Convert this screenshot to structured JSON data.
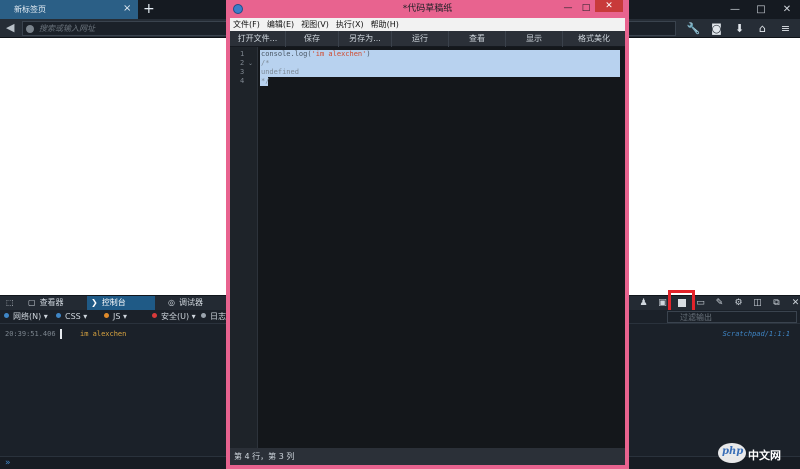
{
  "browser": {
    "tab_title": "新标签页",
    "tab_close": "×",
    "new_tab": "+",
    "window_controls": [
      "—",
      "□",
      "✕"
    ],
    "url_placeholder": "搜索或输入网址",
    "nav_icons": [
      "wrench-icon",
      "pocket-icon",
      "download-icon",
      "home-icon",
      "menu-icon"
    ],
    "nav_glyphs": [
      "🔧",
      "◙",
      "⬇",
      "⌂",
      "≡"
    ]
  },
  "devtools": {
    "tabs": [
      {
        "label": "查看器",
        "icon": "inspector-icon",
        "glyph": "▢"
      },
      {
        "label": "控制台",
        "icon": "console-icon",
        "glyph": "❯"
      },
      {
        "label": "调试器",
        "icon": "debugger-icon",
        "glyph": "◎"
      }
    ],
    "right_icons": [
      "paintbrush-icon",
      "frames-icon",
      "scratchpad-icon",
      "responsive-icon",
      "eyedropper-icon",
      "gear-icon",
      "dock-side-icon",
      "popout-icon",
      "close-icon"
    ],
    "right_glyphs": [
      "♟",
      "▣",
      "",
      "▭",
      "✎",
      "⚙",
      "◫",
      "⧉",
      "✕"
    ],
    "filters": [
      {
        "label": "网络(N)",
        "dot": "#3f86c6",
        "arrow": "▾"
      },
      {
        "label": "CSS",
        "dot": "#3f86c6",
        "arrow": "▾"
      },
      {
        "label": "JS",
        "dot": "#e08b2a",
        "arrow": "▾"
      },
      {
        "label": "安全(U)",
        "dot": "#d83a3a",
        "arrow": "▾"
      },
      {
        "label": "日志",
        "dot": "#9aa3ac",
        "arrow": ""
      }
    ],
    "filter_placeholder": "过滤输出",
    "log": {
      "time": "20:39:51.406",
      "message": "im alexchen",
      "source": "Scratchpad/1:1:1"
    },
    "prompt": "»"
  },
  "scratchpad": {
    "title": "*代码草稿纸",
    "controls": [
      "—",
      "□"
    ],
    "close": "✕",
    "menu": [
      "文件(F)",
      "编辑(E)",
      "视图(V)",
      "执行(X)",
      "帮助(H)"
    ],
    "toolbar": [
      "打开文件...",
      "保存",
      "另存为...",
      "运行",
      "查看",
      "显示",
      "格式美化"
    ],
    "lines": [
      {
        "num": "1",
        "fold": ""
      },
      {
        "num": "2",
        "fold": "⌄"
      },
      {
        "num": "3",
        "fold": ""
      },
      {
        "num": "4",
        "fold": ""
      }
    ],
    "code": {
      "line1_fn": "console.log(",
      "line1_str": "'im alexchen'",
      "line1_end": ")",
      "line2": "/*",
      "line3": "undefined",
      "line4": "*/"
    },
    "status": "第 4 行，第 3 列"
  },
  "watermark": {
    "logo": "php",
    "text": "中文网"
  },
  "colors": {
    "accent": "#1f5a86",
    "scratchpad_frame": "#e8638f",
    "highlight": "#e3232a"
  }
}
